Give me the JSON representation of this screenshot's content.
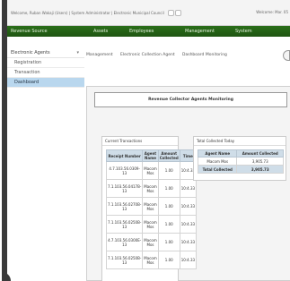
{
  "browser": {
    "breadcrumb": "Welcome, Ruban Wakaji (Users) | System Administrator | Electronic Municipal Council",
    "welcome": "Welcome: Mar. 05"
  },
  "nav": {
    "items": [
      "Revenue Source",
      "Assets",
      "Employees",
      "Management",
      "System"
    ]
  },
  "sidebar": {
    "header": "Electronic Agents",
    "items": [
      {
        "label": "Registration",
        "active": false
      },
      {
        "label": "Transaction",
        "active": false
      },
      {
        "label": "Dashboard",
        "active": true
      }
    ]
  },
  "subnav": {
    "items": [
      "Management",
      "Electronic Collection Agent",
      "Dashboard Monitoring"
    ]
  },
  "panel": {
    "title": "Revenue Collector Agents Monitoring",
    "transactions": {
      "title": "Current Transactions",
      "columns": [
        "Receipt Number",
        "Agent Name",
        "Amount Collected",
        "Time"
      ],
      "rows": [
        [
          "4.7.103.56.0309-13",
          "Macom Mos",
          "1.00",
          "10:4.33"
        ],
        [
          "7.1.103.56.0417B-13",
          "Macom Mos",
          "1.00",
          "10:4.33"
        ],
        [
          "7.1.103.56.0270B-13",
          "Macom Mos",
          "1.00",
          "10:4.33"
        ],
        [
          "7.1.103.56.0250B-13",
          "Macom Mos",
          "1.00",
          "10:4.33"
        ],
        [
          "4.7.103.56.0300E-13",
          "Macom Mos",
          "1.00",
          "10:4.33"
        ],
        [
          "7.1.103.56.0250B-13",
          "Macom Mos",
          "1.00",
          "10:4.33"
        ]
      ]
    },
    "totals": {
      "title": "Total Collected Today",
      "columns": [
        "Agent Name",
        "Amount Collected"
      ],
      "rows": [
        [
          "Macom Mos",
          "3,905.73"
        ]
      ],
      "total_label": "Total Collected",
      "total_value": "3,905.73"
    }
  }
}
